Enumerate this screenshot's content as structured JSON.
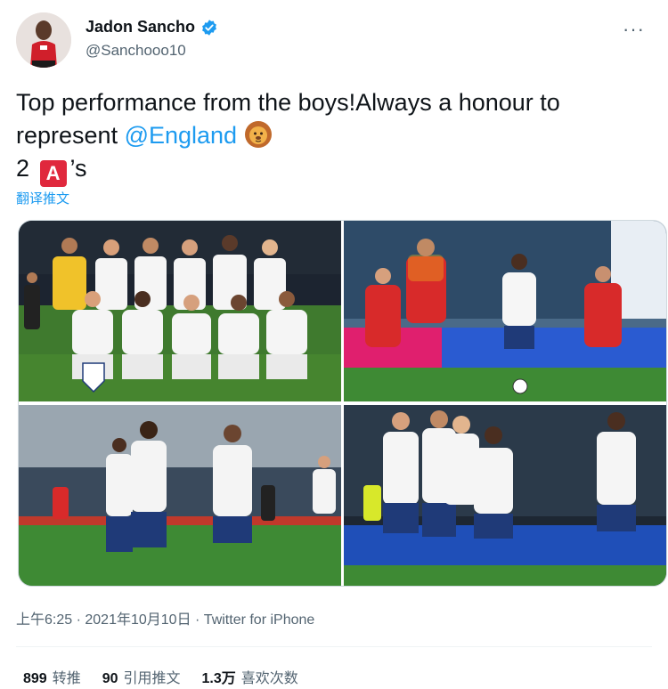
{
  "author": {
    "name": "Jadon Sancho",
    "handle": "@Sanchooo10",
    "avatar_icon": "player-avatar",
    "verified_icon": "verified-badge-icon"
  },
  "more_icon_label": "···",
  "tweet": {
    "line1": "Top performance from the boys!Always a honour to",
    "line2_prefix": "represent ",
    "mention": "@England",
    "lion_icon": "lion-emoji",
    "line3_number": "2",
    "a_badge": "A",
    "line3_suffix": "’s"
  },
  "translate_label": "翻译推文",
  "photos": [
    {
      "name": "team-photo-lineup"
    },
    {
      "name": "match-action-photo"
    },
    {
      "name": "goal-celebration-photo"
    },
    {
      "name": "team-hug-photo"
    }
  ],
  "meta": {
    "time": "上午6:25",
    "date": "2021年10月10日",
    "sep": " · ",
    "source": "Twitter for iPhone"
  },
  "stats": [
    {
      "count": "899",
      "label": "转推"
    },
    {
      "count": "90",
      "label": "引用推文"
    },
    {
      "count": "1.3万",
      "label": "喜欢次数"
    }
  ],
  "colors": {
    "accent": "#1d9bf0",
    "text": "#0f1419",
    "secondary": "#536471",
    "england_red": "#e0283d"
  }
}
